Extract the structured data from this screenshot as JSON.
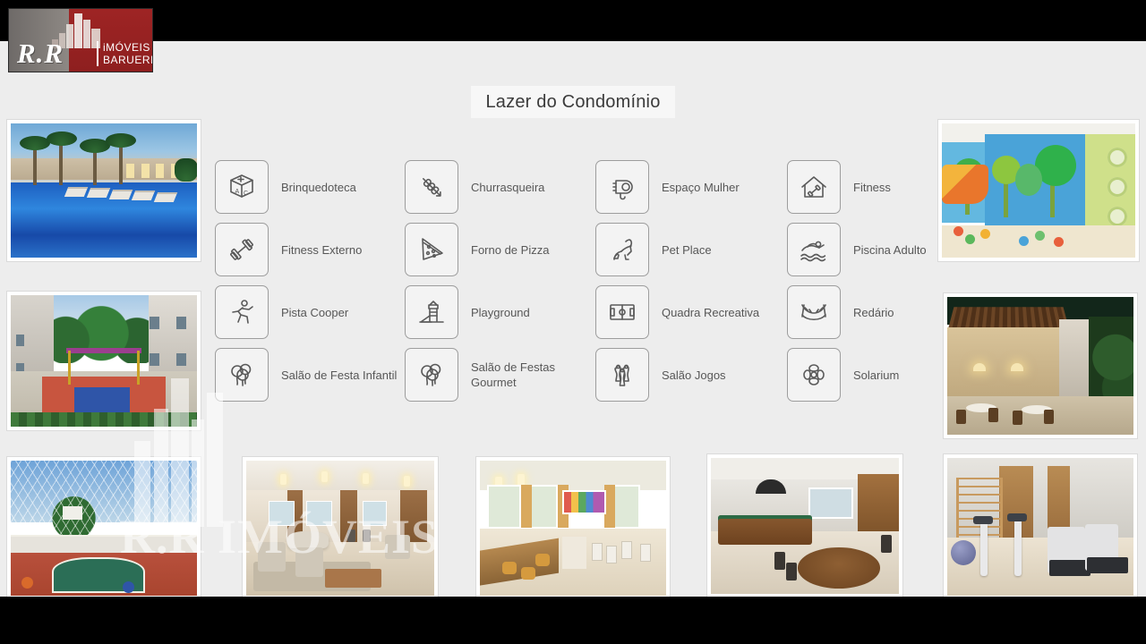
{
  "slide": {
    "title": "Lazer do Condomínio",
    "background_color": "#ededed",
    "letterbox_color": "#000000"
  },
  "logo": {
    "initials": "R.R",
    "line1": "iMÓVEIS",
    "line2": "BARUERI",
    "red": "#8f2222",
    "gray": "#85807c"
  },
  "amenities": [
    {
      "label": "Brinquedoteca",
      "icon": "toy-blocks-icon",
      "col": 0,
      "row": 0
    },
    {
      "label": "Fitness Externo",
      "icon": "dumbbell-icon",
      "col": 0,
      "row": 1
    },
    {
      "label": "Pista Cooper",
      "icon": "runner-icon",
      "col": 0,
      "row": 2
    },
    {
      "label": "Salão de Festa Infantil",
      "icon": "balloons-icon",
      "col": 0,
      "row": 3
    },
    {
      "label": "Churrasqueira",
      "icon": "skewer-icon",
      "col": 1,
      "row": 0
    },
    {
      "label": "Forno de Pizza",
      "icon": "pizza-slice-icon",
      "col": 1,
      "row": 1
    },
    {
      "label": "Playground",
      "icon": "playground-icon",
      "col": 1,
      "row": 2
    },
    {
      "label": "Salão de Festas Gourmet",
      "icon": "balloons-icon",
      "col": 1,
      "row": 3
    },
    {
      "label": "Espaço Mulher",
      "icon": "hairdryer-icon",
      "col": 2,
      "row": 0
    },
    {
      "label": "Pet Place",
      "icon": "dog-icon",
      "col": 2,
      "row": 1
    },
    {
      "label": "Quadra Recreativa",
      "icon": "sports-field-icon",
      "col": 2,
      "row": 2
    },
    {
      "label": "Salão Jogos",
      "icon": "bowling-pins-icon",
      "col": 2,
      "row": 3
    },
    {
      "label": "Fitness",
      "icon": "home-gym-icon",
      "col": 3,
      "row": 0
    },
    {
      "label": "Piscina Adulto",
      "icon": "swimmer-icon",
      "col": 3,
      "row": 1
    },
    {
      "label": "Redário",
      "icon": "hammock-icon",
      "col": 3,
      "row": 2
    },
    {
      "label": "Solarium",
      "icon": "sun-flower-icon",
      "col": 3,
      "row": 3
    }
  ],
  "photos": [
    {
      "id": "ph-pool",
      "caption": "Piscina adulto com espreguiçadeiras e palmeiras"
    },
    {
      "id": "ph-playcourt",
      "caption": "Playground e quadra infantil entre os blocos"
    },
    {
      "id": "ph-sportcourt",
      "caption": "Quadra recreativa coberta com alambrado"
    },
    {
      "id": "ph-lounge",
      "caption": "Salão de festas / lounge mobiliado"
    },
    {
      "id": "ph-gourmet",
      "caption": "Salão de festas gourmet com bar"
    },
    {
      "id": "ph-games",
      "caption": "Salão de jogos com mesa de sinuca"
    },
    {
      "id": "ph-gym",
      "caption": "Fitness com bicicletas e esteiras"
    },
    {
      "id": "ph-kids",
      "caption": "Brinquedoteca colorida com escorregador"
    },
    {
      "id": "ph-grill",
      "caption": "Espaço churrasqueira com pergolado"
    }
  ],
  "watermark": {
    "text": "R.R IMÓVEIS"
  }
}
